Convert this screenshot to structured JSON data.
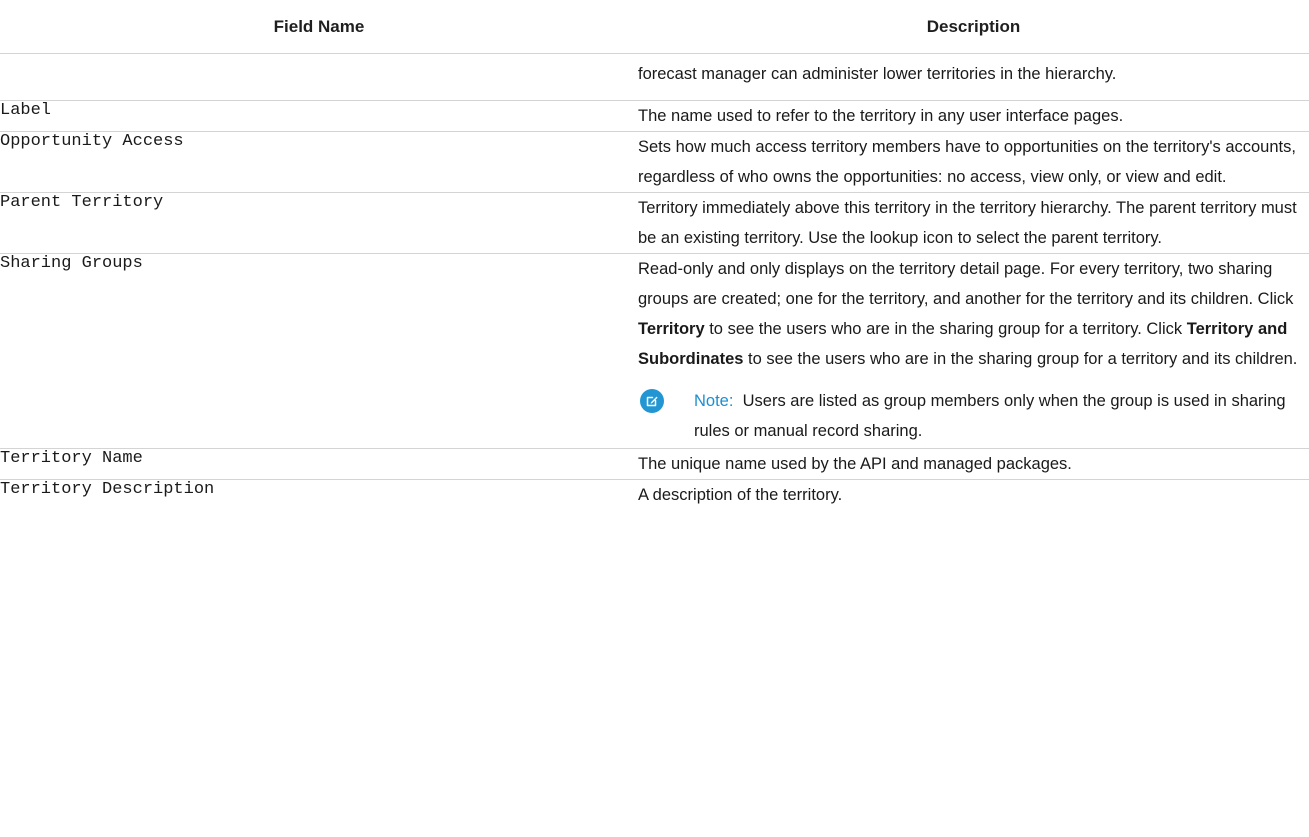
{
  "table": {
    "headers": {
      "field_name": "Field Name",
      "description": "Description"
    },
    "rows": [
      {
        "field": "",
        "desc": [
          {
            "t": "forecast manager can administer lower territories in the hierarchy."
          }
        ]
      },
      {
        "field": "Label",
        "desc": [
          {
            "t": "The name used to refer to the territory in any user interface pages."
          }
        ]
      },
      {
        "field": "Opportunity Access",
        "desc": [
          {
            "t": "Sets how much access territory members have to opportunities on the territory's accounts, regardless of who owns the opportunities: no access, view only, or view and edit."
          }
        ]
      },
      {
        "field": "Parent Territory",
        "desc": [
          {
            "t": "Territory immediately above this territory in the territory hierarchy. The parent territory must be an existing territory. Use the lookup icon to select the parent territory."
          }
        ]
      },
      {
        "field": "Sharing Groups",
        "desc": [
          {
            "t": "Read-only and only displays on the territory detail page. For every territory, two sharing groups are created; one for the territory, and another for the territory and its children. Click "
          },
          {
            "t": "Territory",
            "b": true
          },
          {
            "t": " to see the users who are in the sharing group for a territory. Click "
          },
          {
            "t": "Territory and Subordinates",
            "b": true
          },
          {
            "t": " to see the users who are in the sharing group for a territory and its children."
          }
        ],
        "note": {
          "icon": "edit-note-icon",
          "label": "Note:",
          "text": "Users are listed as group members only when the group is used in sharing rules or manual record sharing."
        }
      },
      {
        "field": "Territory Name",
        "desc": [
          {
            "t": "The unique name used by the API and managed packages."
          }
        ]
      },
      {
        "field": "Territory Description",
        "desc": [
          {
            "t": "A description of the territory."
          }
        ]
      }
    ]
  },
  "colors": {
    "note_accent": "#2196d3",
    "rule": "#d4d4d4"
  }
}
